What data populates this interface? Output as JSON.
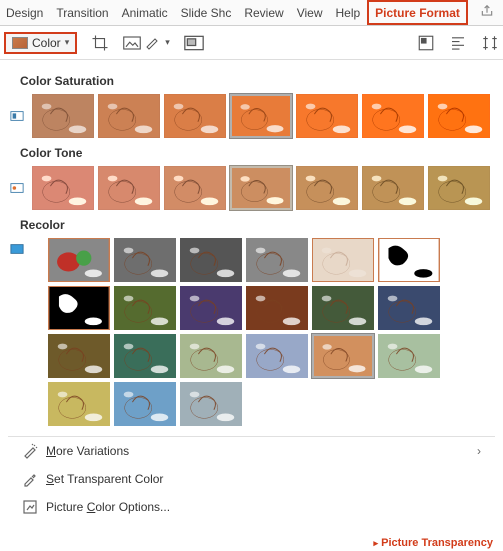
{
  "tabs": {
    "design": "Design",
    "transitions": "Transition",
    "animations": "Animatic",
    "slideshow": "Slide Shc",
    "review": "Review",
    "view": "View",
    "help": "Help",
    "picture_format": "Picture Format"
  },
  "toolbar": {
    "color_label": "Color"
  },
  "sections": {
    "saturation": "Color Saturation",
    "tone": "Color Tone",
    "recolor": "Recolor"
  },
  "menu": {
    "more_variations": "More Variations",
    "set_transparent": "Set Transparent Color",
    "color_options": "Picture Color Options..."
  },
  "footer": {
    "transparency": "Picture Transparency"
  },
  "icons": {
    "share": "share-icon",
    "crop": "crop-icon",
    "artistic": "artistic-effects-icon",
    "transparency": "transparency-icon",
    "position": "position-icon",
    "align": "align-icon",
    "size": "size-icon",
    "wand": "magic-wand-icon",
    "eyedropper": "eyedropper-icon",
    "gear": "format-icon"
  },
  "thumbnails": {
    "saturation_count": 7,
    "saturation_selected_index": 3,
    "tone_count": 7,
    "tone_selected_index": 3,
    "recolor_colors": [
      "#808080",
      "#6e6e6e",
      "#555",
      "#888",
      "#f5f5f5",
      "#ffffff",
      "#000000",
      "#556b2f",
      "#4a3a6e",
      "#7a3b1e",
      "#445a3a",
      "#3a4a6e",
      "#6e5a2a",
      "#3a6e5a",
      "#a8b890",
      "#98a8c8",
      "#d2905e",
      "#a8c0a0",
      "#c8b860",
      "#6ea0c8",
      "#a0b0b8"
    ],
    "recolor_selected_index": 16
  }
}
